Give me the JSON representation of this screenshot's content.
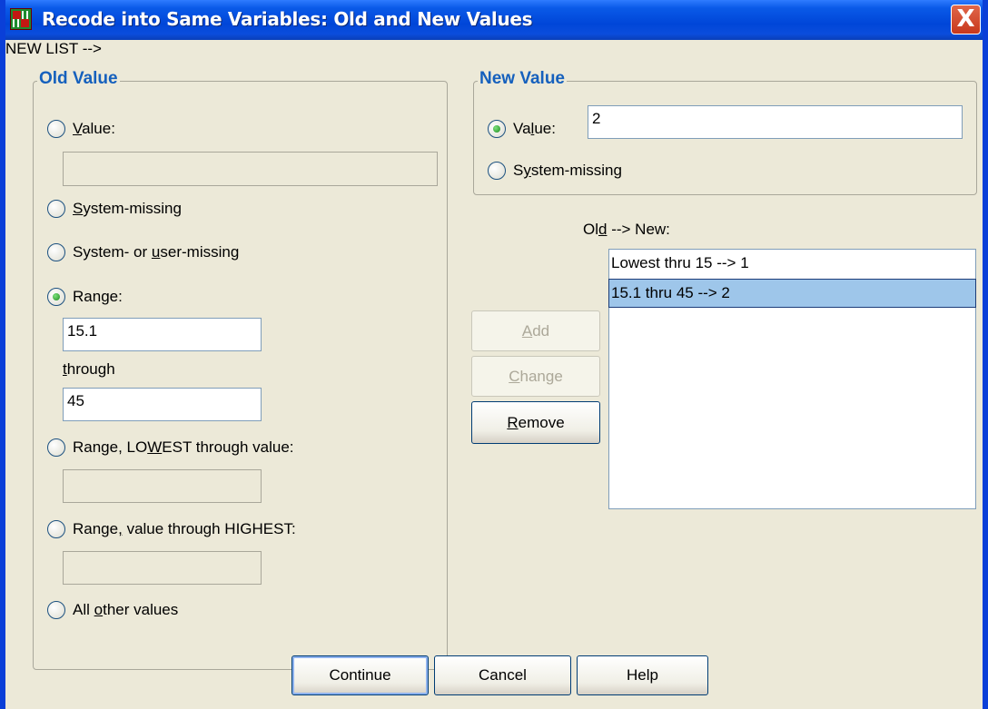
{
  "window": {
    "title": "Recode into Same Variables: Old and New Values",
    "close_glyph": "X"
  },
  "old_value": {
    "legend": "Old Value",
    "value": {
      "pre": "",
      "accel": "V",
      "post": "alue:",
      "checked": false,
      "field_value": ""
    },
    "system_missing": {
      "pre": "",
      "accel": "S",
      "post": "ystem-missing",
      "checked": false
    },
    "system_or_user_missing": {
      "pre": "System- or ",
      "accel": "u",
      "post": "ser-missing",
      "checked": false
    },
    "range": {
      "pre": "Ran",
      "accel": "g",
      "post": "e:",
      "checked": true,
      "from": "15.1",
      "through_pre": "",
      "through_accel": "t",
      "through_post": "hrough",
      "to": "45"
    },
    "range_lowest": {
      "pre": "Range, LO",
      "accel": "W",
      "post": "EST through value:",
      "checked": false,
      "field_value": ""
    },
    "range_highest": {
      "pre": "Range",
      "accel": ",",
      "post": " value through HIGHEST:",
      "checked": false,
      "field_value": ""
    },
    "all_other": {
      "pre": "All ",
      "accel": "o",
      "post": "ther values",
      "checked": false
    }
  },
  "new_value": {
    "legend": "New Value",
    "value": {
      "pre": "Va",
      "accel": "l",
      "post": "ue:",
      "checked": true,
      "field_value": "2"
    },
    "system_missing": {
      "pre": "S",
      "accel": "y",
      "post": "stem-missing",
      "checked": false
    }
  },
  "mapping": {
    "label_pre": "Ol",
    "label_accel": "d",
    "label_post": " --> New:",
    "items": [
      "Lowest thru 15 --> 1",
      "15.1 thru 45 --> 2"
    ],
    "selected_index": 1
  },
  "buttons": {
    "add": {
      "accel": "A",
      "post": "dd",
      "enabled": false
    },
    "change": {
      "accel": "C",
      "post": "hange",
      "enabled": false
    },
    "remove": {
      "accel": "R",
      "post": "emove",
      "enabled": true
    },
    "continue": "Continue",
    "cancel": "Cancel",
    "help": "Help"
  }
}
